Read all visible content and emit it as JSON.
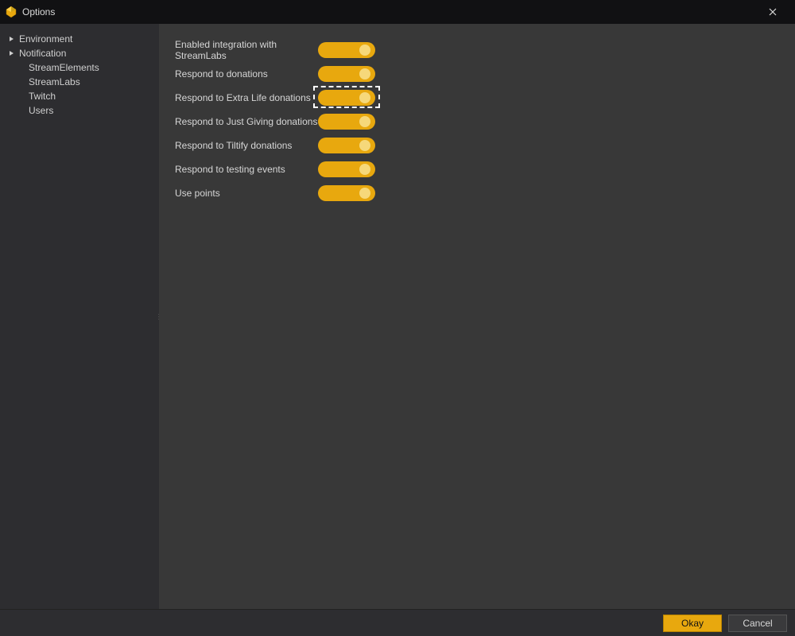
{
  "window": {
    "title": "Options"
  },
  "sidebar": {
    "items": [
      {
        "label": "Environment",
        "hasChildren": true
      },
      {
        "label": "Notification",
        "hasChildren": true
      },
      {
        "label": "StreamElements",
        "hasChildren": false
      },
      {
        "label": "StreamLabs",
        "hasChildren": false
      },
      {
        "label": "Twitch",
        "hasChildren": false
      },
      {
        "label": "Users",
        "hasChildren": false
      }
    ]
  },
  "settings": {
    "rows": [
      {
        "label": "Enabled integration with StreamLabs",
        "on": true,
        "highlighted": false
      },
      {
        "label": "Respond to donations",
        "on": true,
        "highlighted": false
      },
      {
        "label": "Respond to Extra Life donations",
        "on": true,
        "highlighted": true
      },
      {
        "label": "Respond to Just Giving donations",
        "on": true,
        "highlighted": false
      },
      {
        "label": "Respond to Tiltify donations",
        "on": true,
        "highlighted": false
      },
      {
        "label": "Respond to testing events",
        "on": true,
        "highlighted": false
      },
      {
        "label": "Use points",
        "on": true,
        "highlighted": false
      }
    ]
  },
  "footer": {
    "okay": "Okay",
    "cancel": "Cancel"
  },
  "colors": {
    "accent": "#e8a80e",
    "bg": "#2d2d30",
    "panel": "#383838"
  }
}
